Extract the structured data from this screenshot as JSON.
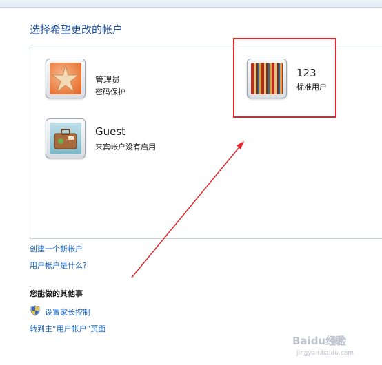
{
  "page": {
    "title": "选择希望更改的帐户"
  },
  "accounts": [
    {
      "name": "管理员",
      "status": "密码保护",
      "picture": "starfish-picture"
    },
    {
      "name": "123",
      "status": "标准用户",
      "picture": "books-picture"
    },
    {
      "name": "Guest",
      "status": "来宾帐户没有启用",
      "picture": "suitcase-picture"
    }
  ],
  "links": {
    "create_account": "创建一个新帐户",
    "what_is_account": "用户帐户是什么?"
  },
  "other_tasks": {
    "heading": "您能做的其他事",
    "parental_controls": "设置家长控制",
    "go_to_main": "转到主“用户帐户”页面",
    "parental_icon": "uac-shield-icon"
  },
  "watermark": {
    "text": "Baidu经验",
    "sub": "jingyan.baidu.com"
  },
  "colors": {
    "link": "#1563c7",
    "title": "#1e4f9c",
    "annotation": "#e0262a"
  }
}
